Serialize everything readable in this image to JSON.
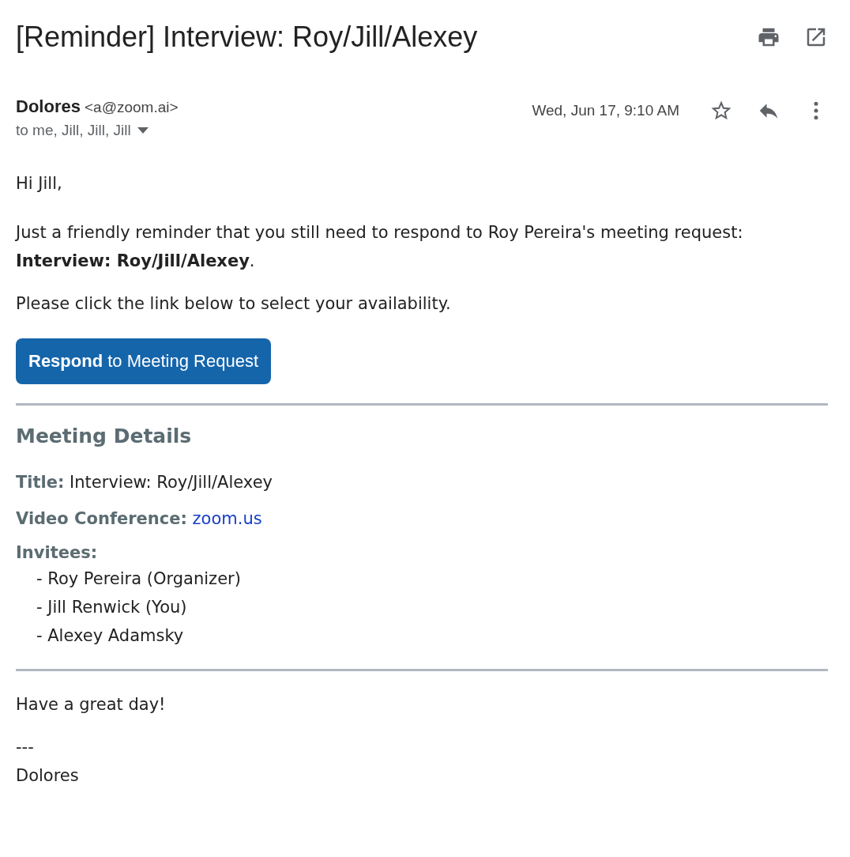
{
  "subject": "[Reminder] Interview: Roy/Jill/Alexey",
  "sender": {
    "name": "Dolores",
    "email": "<a@zoom.ai>",
    "recipients": "to me, Jill, Jill, Jill"
  },
  "date": "Wed, Jun 17, 9:10 AM",
  "starred": false,
  "body": {
    "greeting": "Hi Jill,",
    "paragraphs": [
      "Just a friendly reminder that you still need to respond to Roy Pereira's meeting request: **Interview: Roy/Jill/Alexey**.",
      "Please click the link below to select your availability."
    ],
    "button": "**Respond** to Meeting Request"
  },
  "details": {
    "heading": "Meeting Details",
    "fields": [
      {
        "label": "Title:",
        "value": "Interview: Roy/Jill/Alexey",
        "kind": "text"
      },
      {
        "label": "Video Conference:",
        "value": "zoom.us",
        "kind": "link"
      }
    ],
    "invitees_label": "Invitees:",
    "invitees": [
      "- Roy Pereira (Organizer)",
      "- Jill Renwick (You)",
      "- Alexey Adamsky"
    ]
  },
  "closing": "Have a great day!",
  "signature": [
    "---",
    "Dolores"
  ]
}
